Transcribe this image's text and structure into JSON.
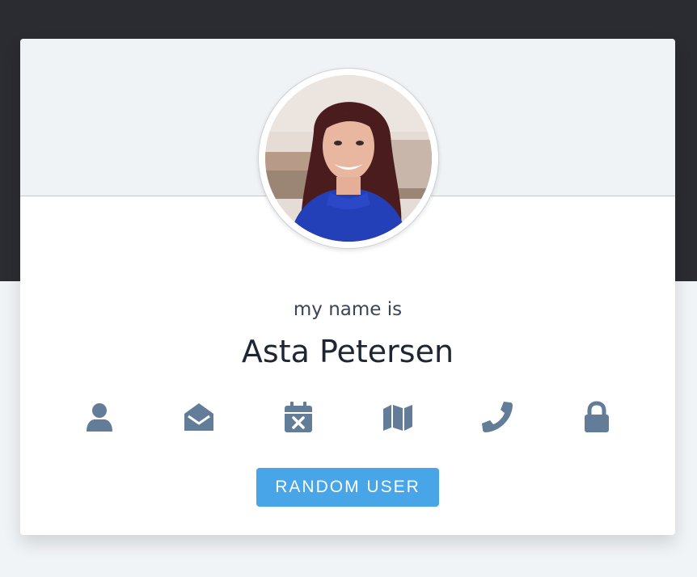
{
  "profile": {
    "label": "my name is",
    "name": "Asta Petersen"
  },
  "icons": [
    {
      "name": "user-icon",
      "hint": "name"
    },
    {
      "name": "envelope-open-icon",
      "hint": "email"
    },
    {
      "name": "calendar-x-icon",
      "hint": "birthday"
    },
    {
      "name": "map-icon",
      "hint": "address"
    },
    {
      "name": "phone-icon",
      "hint": "phone"
    },
    {
      "name": "lock-icon",
      "hint": "password"
    }
  ],
  "button": {
    "label": "RANDOM USER"
  },
  "colors": {
    "background_top": "#2a2c31",
    "background_bottom": "#f1f4f7",
    "card": "#ffffff",
    "card_header": "#f0f3f6",
    "icon": "#637c98",
    "button": "#47a5e8"
  }
}
